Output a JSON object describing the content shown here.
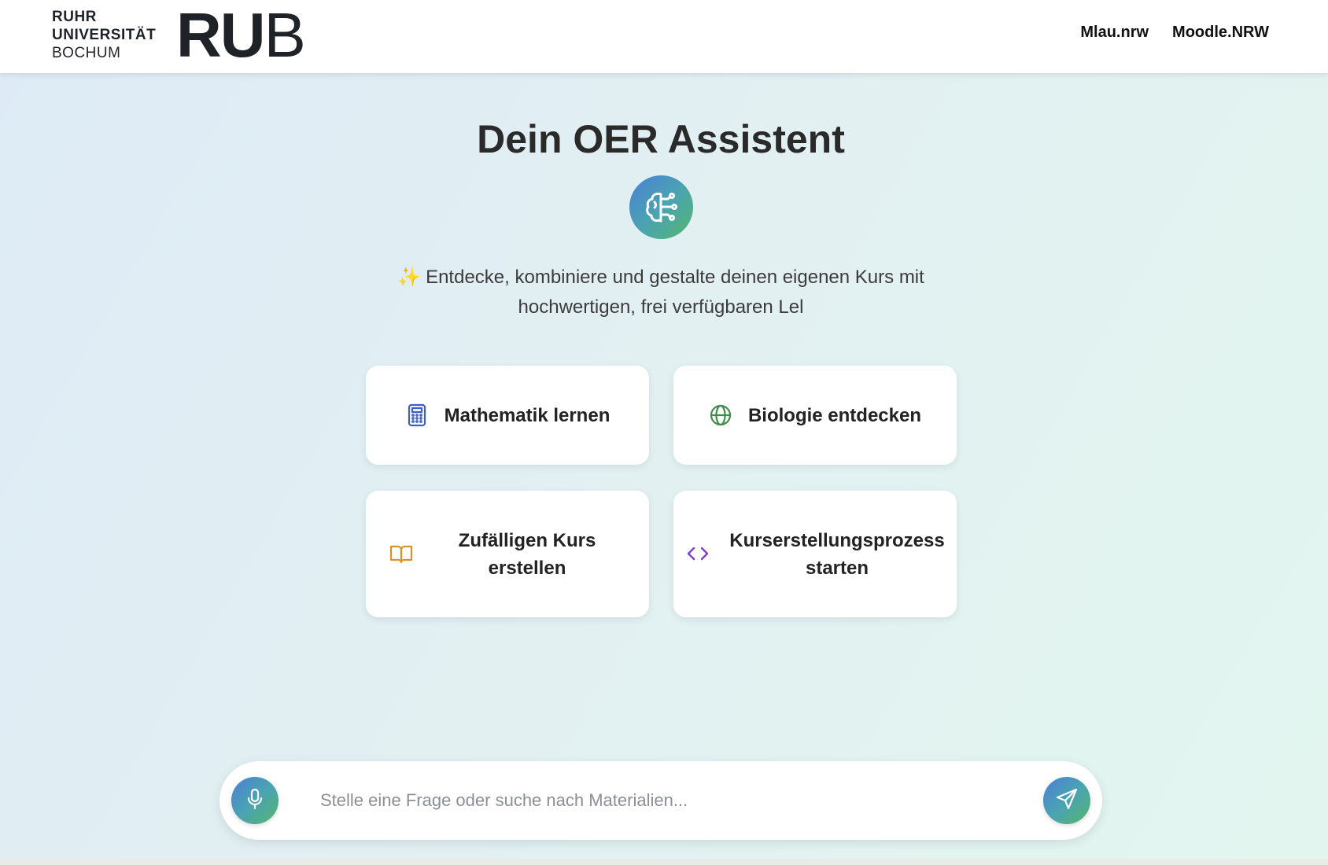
{
  "header": {
    "logo": {
      "line1": "RUHR",
      "line2": "UNIVERSITÄT",
      "line3": "BOCHUM",
      "mark_bold": "RU",
      "mark_light": "B"
    },
    "nav": [
      "Mlau.nrw",
      "Moodle.NRW"
    ]
  },
  "main": {
    "title": "Dein OER Assistent",
    "badge_icon": "brain-circuit-icon",
    "subtitle_icon": "sparkles-icon",
    "subtitle": "Entdecke, kombiniere und gestalte deinen eigenen Kurs mit hochwertigen, frei verfügbaren Lel"
  },
  "cards": [
    {
      "label": "Mathematik lernen",
      "icon": "calculator-icon",
      "color": "#3b5fc9"
    },
    {
      "label": "Biologie entdecken",
      "icon": "globe-icon",
      "color": "#3e8e4a"
    },
    {
      "label": "Zufälligen Kurs erstellen",
      "icon": "book-open-icon",
      "color": "#d4942c"
    },
    {
      "label": "Kurserstellungsprozess starten",
      "icon": "code-icon",
      "color": "#7b3fd0"
    }
  ],
  "chat": {
    "placeholder": "Stelle eine Frage oder suche nach Materialien...",
    "mic_icon": "microphone-icon",
    "send_icon": "send-icon"
  },
  "colors": {
    "accent_gradient": [
      "#4a7fd6",
      "#4aa3b2",
      "#55b66d"
    ],
    "background": [
      "#deebf6",
      "#e2f6ef"
    ]
  }
}
